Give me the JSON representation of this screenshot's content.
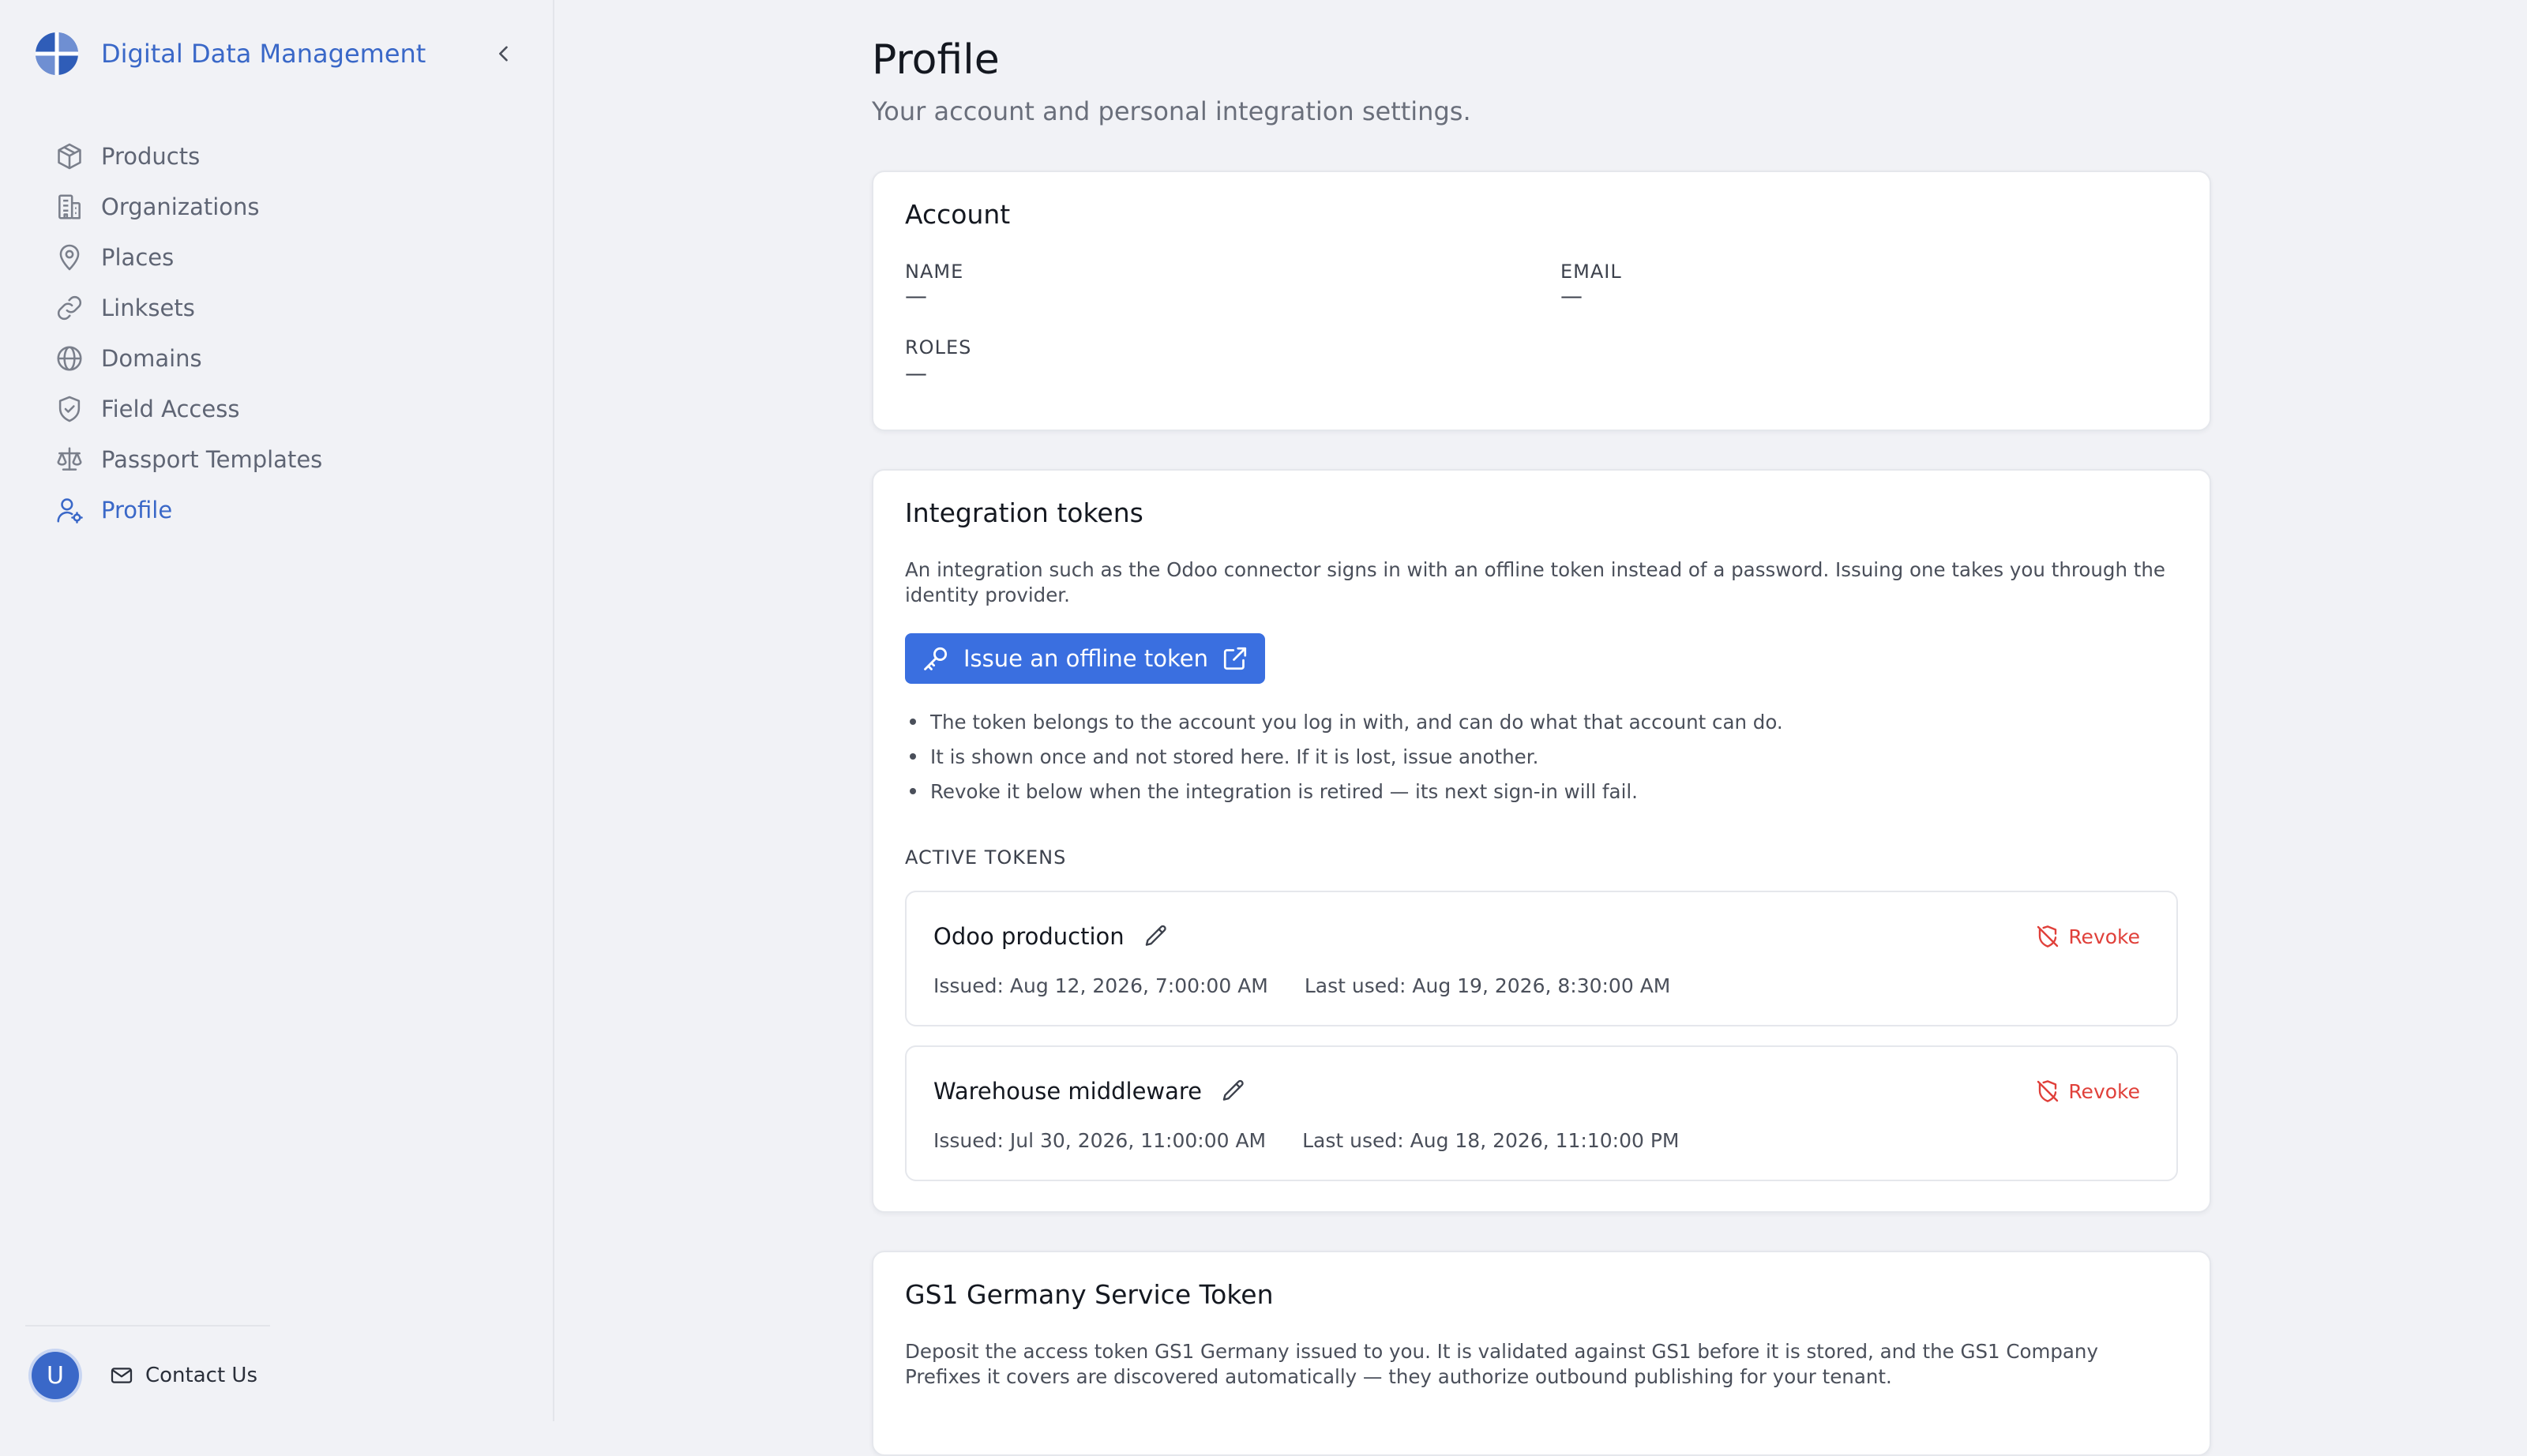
{
  "sidebar": {
    "brand_title": "Digital Data Management",
    "items": [
      {
        "label": "Products",
        "icon": "box-icon"
      },
      {
        "label": "Organizations",
        "icon": "building-icon"
      },
      {
        "label": "Places",
        "icon": "map-pin-icon"
      },
      {
        "label": "Linksets",
        "icon": "link-icon"
      },
      {
        "label": "Domains",
        "icon": "globe-icon"
      },
      {
        "label": "Field Access",
        "icon": "shield-check-icon"
      },
      {
        "label": "Passport Templates",
        "icon": "scale-icon"
      },
      {
        "label": "Profile",
        "icon": "user-cog-icon",
        "active": true
      }
    ],
    "avatar_initial": "U",
    "contact_label": "Contact Us"
  },
  "page": {
    "title": "Profile",
    "subtitle": "Your account and personal integration settings."
  },
  "account": {
    "title": "Account",
    "name_label": "NAME",
    "name_value": "—",
    "email_label": "EMAIL",
    "email_value": "—",
    "roles_label": "ROLES",
    "roles_value": "—"
  },
  "integration": {
    "title": "Integration tokens",
    "description": "An integration such as the Odoo connector signs in with an offline token instead of a password. Issuing one takes you through the identity provider.",
    "issue_button": "Issue an offline token",
    "bullets": [
      "The token belongs to the account you log in with, and can do what that account can do.",
      "It is shown once and not stored here. If it is lost, issue another.",
      "Revoke it below when the integration is retired — its next sign-in will fail."
    ],
    "active_label": "ACTIVE TOKENS",
    "revoke_label": "Revoke",
    "tokens": [
      {
        "name": "Odoo production",
        "issued": "Issued: Aug 12, 2026, 7:00:00 AM",
        "last_used": "Last used: Aug 19, 2026, 8:30:00 AM"
      },
      {
        "name": "Warehouse middleware",
        "issued": "Issued: Jul 30, 2026, 11:00:00 AM",
        "last_used": "Last used: Aug 18, 2026, 11:10:00 PM"
      }
    ]
  },
  "gs1": {
    "title": "GS1 Germany Service Token",
    "description": "Deposit the access token GS1 Germany issued to you. It is validated against GS1 before it is stored, and the GS1 Company Prefixes it covers are discovered automatically — they authorize outbound publishing for your tenant."
  },
  "colors": {
    "accent": "#3a68c8",
    "primary_button": "#3a6fe0",
    "danger": "#e0403a",
    "background": "#f1f2f6"
  }
}
